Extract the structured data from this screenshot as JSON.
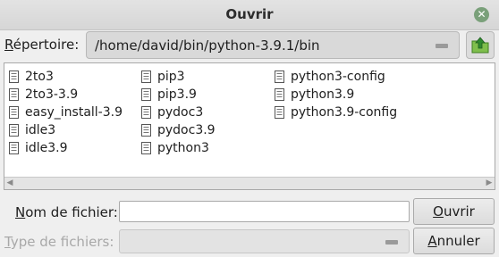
{
  "window": {
    "title": "Ouvrir",
    "close_icon": "close-icon",
    "close_glyph": "✕"
  },
  "directory": {
    "label_mnemonic": "R",
    "label_rest": "épertoire:",
    "path": "/home/david/bin/python-3.9.1/bin"
  },
  "files": {
    "columns": [
      [
        "2to3",
        "2to3-3.9",
        "easy_install-3.9",
        "idle3",
        "idle3.9"
      ],
      [
        "pip3",
        "pip3.9",
        "pydoc3",
        "pydoc3.9",
        "python3"
      ],
      [
        "python3-config",
        "python3.9",
        "python3.9-config"
      ]
    ],
    "scroll_left": "◀",
    "scroll_right": "▶"
  },
  "filename": {
    "label_mnemonic": "N",
    "label_rest": "om de fichier:",
    "value": ""
  },
  "filetype": {
    "label_mnemonic": "T",
    "label_rest": "ype de fichiers:",
    "value": ""
  },
  "buttons": {
    "open_mnemonic": "O",
    "open_rest": "uvrir",
    "cancel_mnemonic": "A",
    "cancel_rest": "nnuler"
  },
  "colors": {
    "up_folder_green": "#4e9a2e",
    "close_button": "#7aa07a"
  }
}
